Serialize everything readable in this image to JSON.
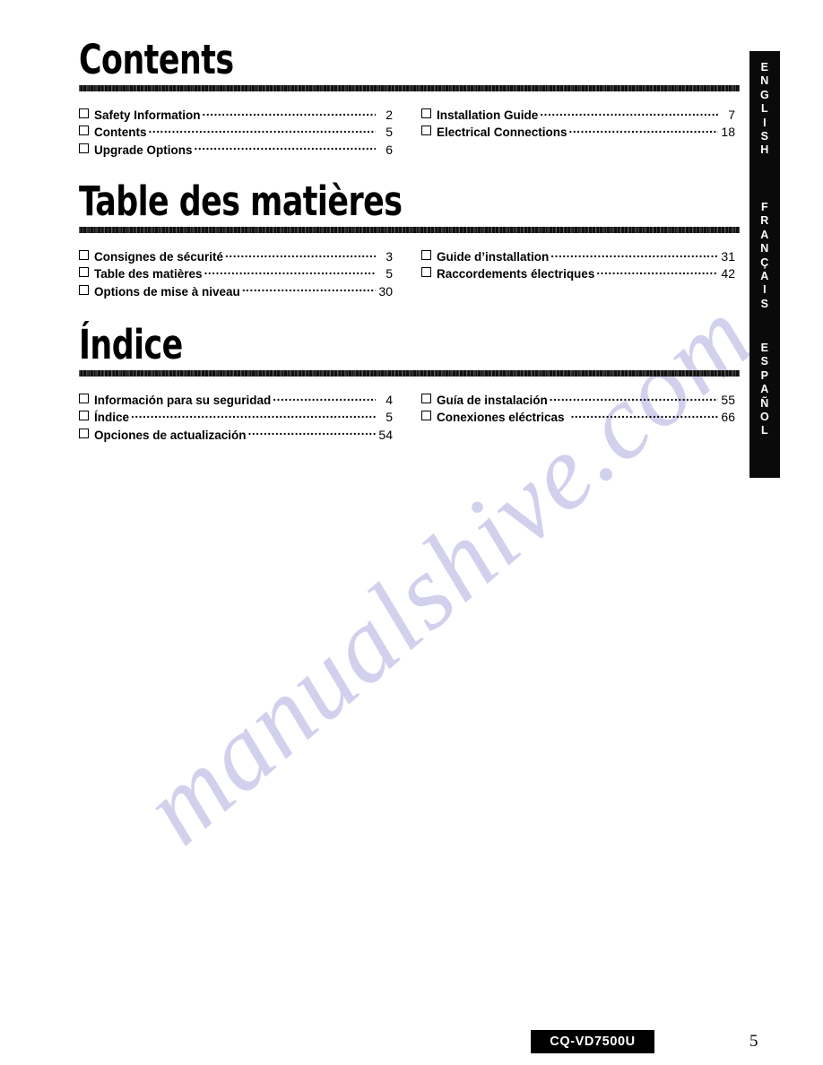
{
  "document": {
    "model": "CQ-VD7500U",
    "page_number": "5",
    "watermark": "manualshive.com"
  },
  "sections": [
    {
      "id": "contents",
      "heading": "Contents",
      "left_entries": [
        {
          "label": "Safety Information",
          "page": "2"
        },
        {
          "label": "Contents",
          "page": "5"
        },
        {
          "label": "Upgrade Options",
          "page": "6"
        }
      ],
      "right_entries": [
        {
          "label": "Installation Guide",
          "page": "7"
        },
        {
          "label": "Electrical Connections",
          "page": "18"
        }
      ]
    },
    {
      "id": "table-des-matieres",
      "heading": "Table des matières",
      "left_entries": [
        {
          "label": "Consignes de sécurité",
          "page": "3"
        },
        {
          "label": "Table des matières",
          "page": "5"
        },
        {
          "label": "Options de mise à niveau",
          "page": "30"
        }
      ],
      "right_entries": [
        {
          "label": "Guide d’installation",
          "page": "31"
        },
        {
          "label": "Raccordements électriques",
          "page": "42"
        }
      ]
    },
    {
      "id": "indice",
      "heading": "Índice",
      "left_entries": [
        {
          "label": "Información para su seguridad",
          "page": "4"
        },
        {
          "label": "Índice",
          "page": "5"
        },
        {
          "label": "Opciones de actualización",
          "page": "54"
        }
      ],
      "right_entries": [
        {
          "label": "Guía de instalación",
          "page": "55"
        },
        {
          "label": "Conexiones eléctricas",
          "page": "66"
        }
      ]
    }
  ],
  "language_tabs": [
    {
      "id": "english",
      "label": "ENGLISH"
    },
    {
      "id": "francais",
      "label": "FRANÇAIS"
    },
    {
      "id": "espanol",
      "label": "ESPAÑOL"
    }
  ],
  "colors": {
    "ink": "#000000",
    "tab_background": "#0a0a0a",
    "tab_text": "#ffffff",
    "watermark": "#c9c9ec",
    "paper": "#ffffff"
  }
}
